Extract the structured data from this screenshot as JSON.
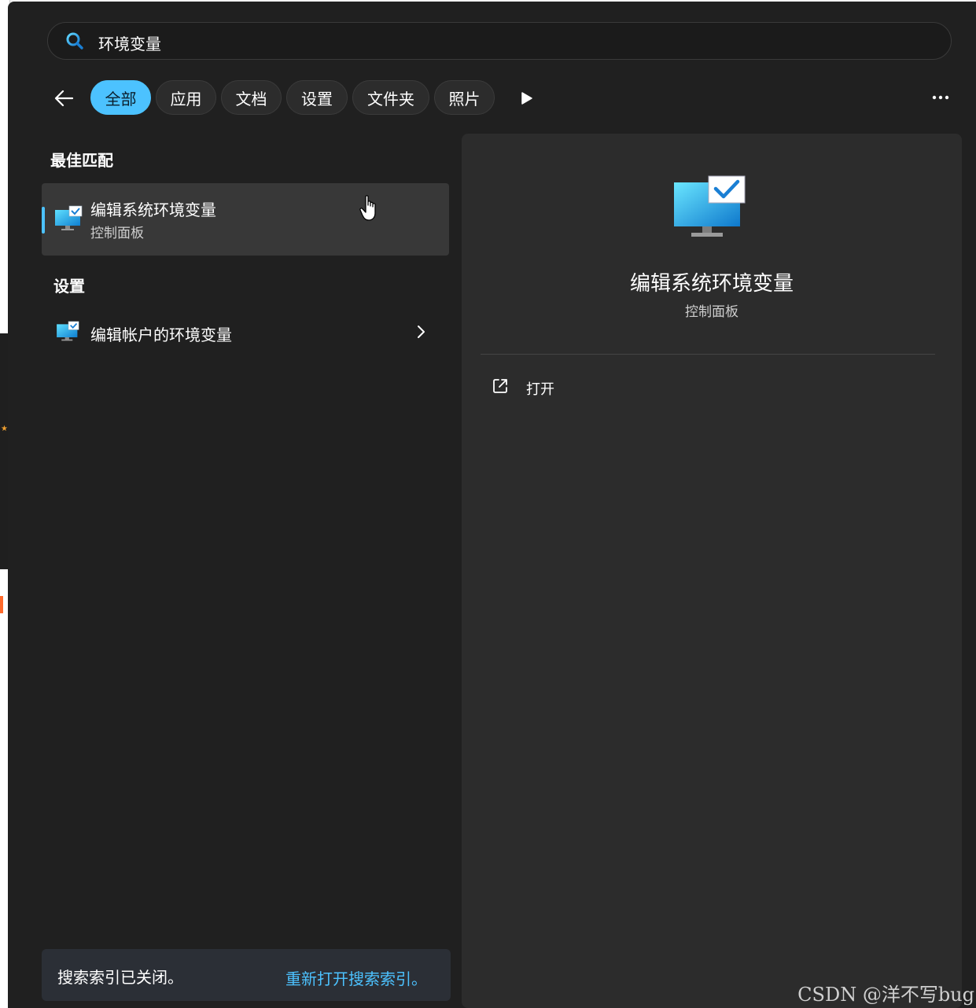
{
  "search": {
    "query": "环境变量"
  },
  "filters": [
    {
      "label": "全部",
      "active": true
    },
    {
      "label": "应用"
    },
    {
      "label": "文档"
    },
    {
      "label": "设置"
    },
    {
      "label": "文件夹"
    },
    {
      "label": "照片"
    }
  ],
  "sections": {
    "best_match": {
      "title": "最佳匹配",
      "item": {
        "title": "编辑系统环境变量",
        "subtitle": "控制面板"
      }
    },
    "settings": {
      "title": "设置",
      "item": {
        "title": "编辑帐户的环境变量"
      }
    }
  },
  "preview": {
    "title": "编辑系统环境变量",
    "subtitle": "控制面板",
    "actions": [
      {
        "label": "打开"
      }
    ]
  },
  "footer": {
    "message": "搜索索引已关闭。",
    "link": "重新打开搜索索引。"
  },
  "watermark": "CSDN @洋不写bug",
  "colors": {
    "accent": "#4cc2ff",
    "panel": "#202020",
    "preview": "#2c2c2c"
  }
}
